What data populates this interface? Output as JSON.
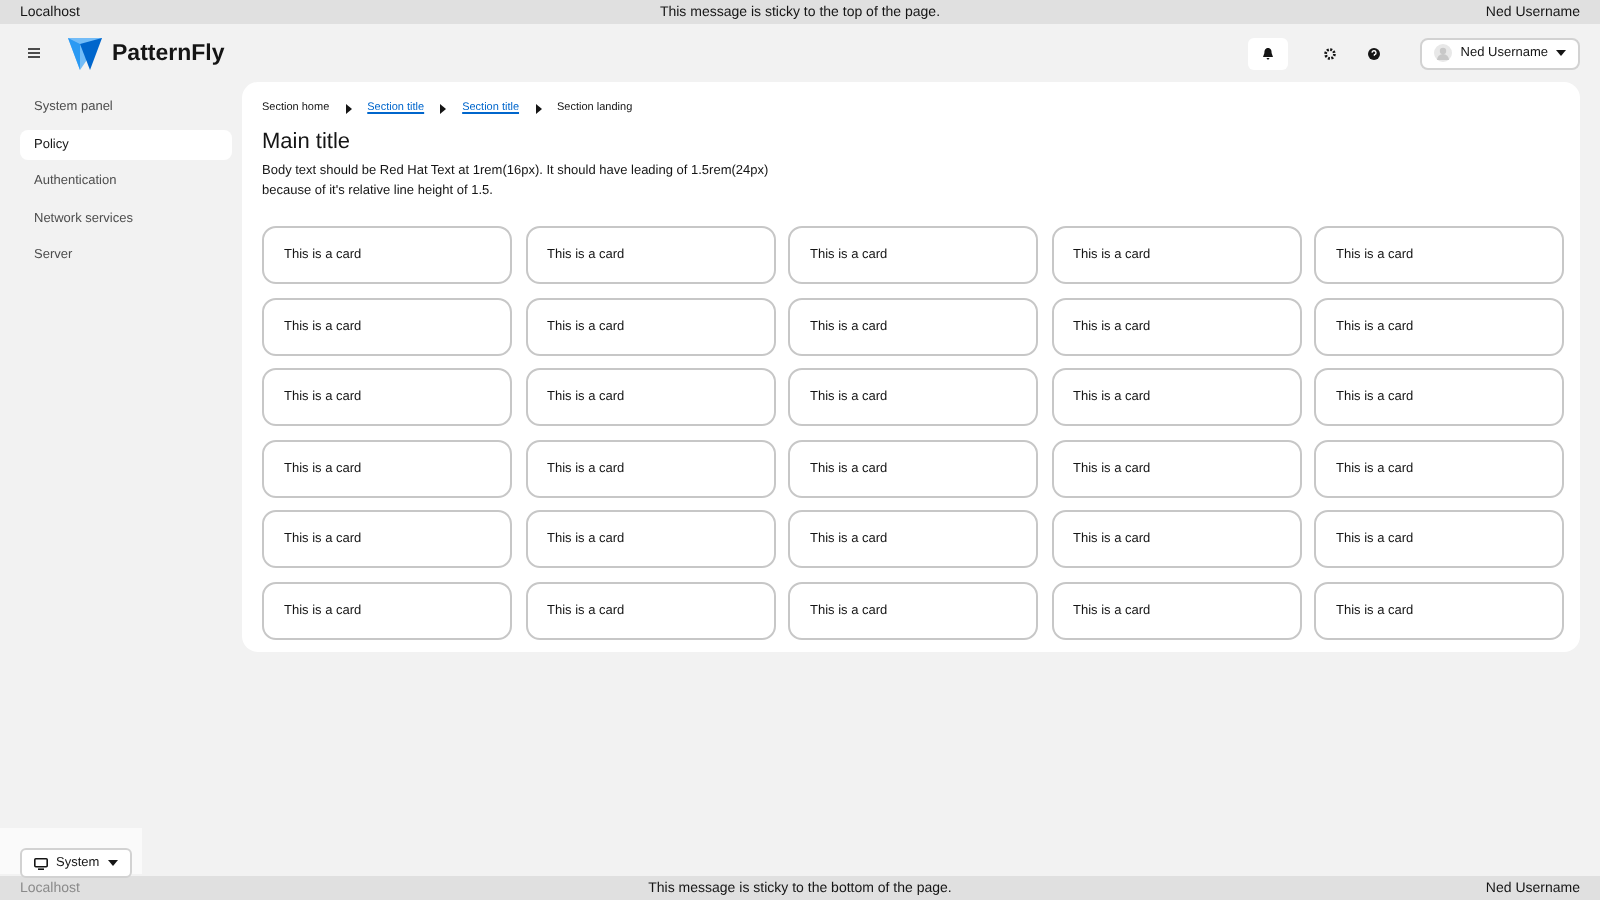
{
  "top_banner": {
    "left": "Localhost",
    "center": "This message is sticky to the top of the page.",
    "right": "Ned Username"
  },
  "masthead": {
    "brand": "PatternFly",
    "user_menu": {
      "label": "Ned Username"
    }
  },
  "sidebar": {
    "items": [
      {
        "label": "System panel",
        "selected": false
      },
      {
        "label": "Policy",
        "selected": true
      },
      {
        "label": "Authentication",
        "selected": false
      },
      {
        "label": "Network services",
        "selected": false
      },
      {
        "label": "Server",
        "selected": false
      }
    ]
  },
  "breadcrumb": [
    {
      "label": "Section home",
      "kind": "text"
    },
    {
      "label": "Section title",
      "kind": "link"
    },
    {
      "label": "Section title",
      "kind": "link"
    },
    {
      "label": "Section landing",
      "kind": "text"
    }
  ],
  "main": {
    "title": "Main title",
    "body": "Body text should be Red Hat Text at 1rem(16px). It should have leading of 1.5rem(24px) because of it's relative line height of 1.5."
  },
  "cards": [
    "This is a card",
    "This is a card",
    "This is a card",
    "This is a card",
    "This is a card",
    "This is a card",
    "This is a card",
    "This is a card",
    "This is a card",
    "This is a card",
    "This is a card",
    "This is a card",
    "This is a card",
    "This is a card",
    "This is a card",
    "This is a card",
    "This is a card",
    "This is a card",
    "This is a card",
    "This is a card",
    "This is a card",
    "This is a card",
    "This is a card",
    "This is a card",
    "This is a card",
    "This is a card",
    "This is a card",
    "This is a card",
    "This is a card",
    "This is a card"
  ],
  "theme_switcher": {
    "label": "System"
  },
  "bottom_banner": {
    "left": "Localhost",
    "center": "This message is sticky to the bottom of the page.",
    "right": "Ned Username"
  }
}
